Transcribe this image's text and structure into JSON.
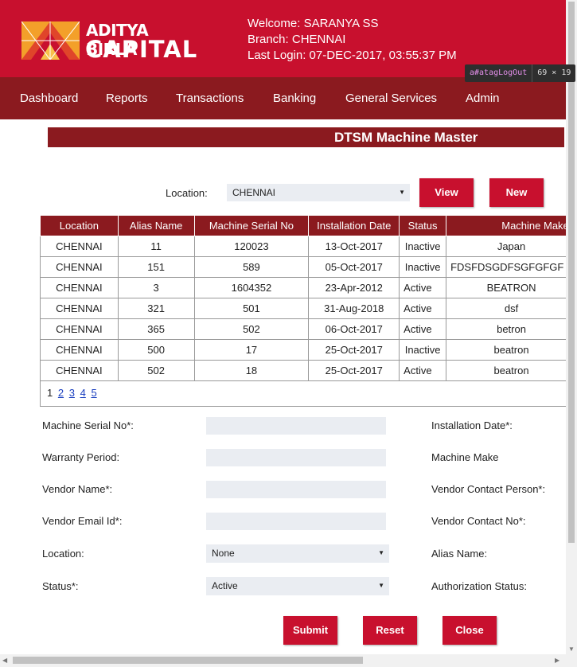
{
  "header": {
    "logo_line1": "ADITYA BIRLA",
    "logo_line2": "CAPITAL",
    "welcome": "Welcome: SARANYA SS",
    "branch": "Branch: CHENNAI",
    "last_login": "Last Login: 07-DEC-2017, 03:55:37 PM"
  },
  "devtools_tooltip": {
    "selector": "a#atagLogOut",
    "size": "69 × 19"
  },
  "nav": {
    "items": [
      "Dashboard",
      "Reports",
      "Transactions",
      "Banking",
      "General Services",
      "Admin"
    ]
  },
  "page_title": "DTSM Machine Master",
  "filter": {
    "location_label": "Location:",
    "location_value": "CHENNAI",
    "view_label": "View",
    "new_label": "New"
  },
  "table": {
    "columns": [
      "Location",
      "Alias Name",
      "Machine Serial No",
      "Installation Date",
      "Status",
      "Machine Make"
    ],
    "rows": [
      [
        "CHENNAI",
        "11",
        "120023",
        "13-Oct-2017",
        "Inactive",
        "Japan"
      ],
      [
        "CHENNAI",
        "151",
        "589",
        "05-Oct-2017",
        "Inactive",
        "FDSFDSGDFSGFGFGF"
      ],
      [
        "CHENNAI",
        "3",
        "1604352",
        "23-Apr-2012",
        "Active",
        "BEATRON"
      ],
      [
        "CHENNAI",
        "321",
        "501",
        "31-Aug-2018",
        "Active",
        "dsf"
      ],
      [
        "CHENNAI",
        "365",
        "502",
        "06-Oct-2017",
        "Active",
        "betron"
      ],
      [
        "CHENNAI",
        "500",
        "17",
        "25-Oct-2017",
        "Inactive",
        "beatron"
      ],
      [
        "CHENNAI",
        "502",
        "18",
        "25-Oct-2017",
        "Active",
        "beatron"
      ]
    ],
    "pager": {
      "current": "1",
      "pages": [
        "2",
        "3",
        "4",
        "5"
      ]
    }
  },
  "form": {
    "machine_serial_label": "Machine Serial No*:",
    "installation_date_label": "Installation Date*:",
    "warranty_label": "Warranty Period:",
    "machine_make_label": "Machine Make",
    "vendor_name_label": "Vendor Name*:",
    "vendor_contact_person_label": "Vendor Contact Person*:",
    "vendor_email_label": "Vendor Email Id*:",
    "vendor_contact_no_label": "Vendor Contact No*:",
    "location_label": "Location:",
    "location_value": "None",
    "alias_label": "Alias Name:",
    "status_label": "Status*:",
    "status_value": "Active",
    "auth_status_label": "Authorization Status:",
    "submit_label": "Submit",
    "reset_label": "Reset",
    "close_label": "Close"
  },
  "colors": {
    "brand_red": "#c8102e",
    "dark_red": "#8b1a1f",
    "logo_orange": "#f3a02a",
    "input_bg": "#eaedf2",
    "link_blue": "#1a3fbf"
  }
}
